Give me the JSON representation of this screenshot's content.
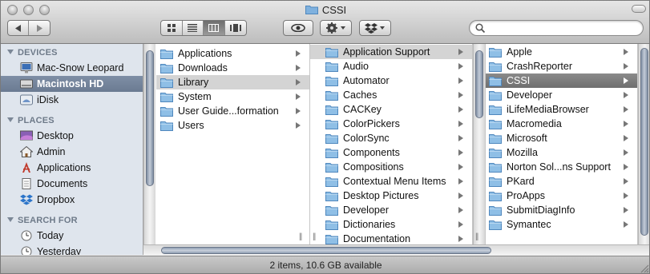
{
  "window": {
    "title": "CSSI"
  },
  "toolbar": {
    "view_buttons": [
      "icon-view",
      "list-view",
      "column-view",
      "coverflow-view"
    ],
    "active_view": "column-view"
  },
  "sidebar": {
    "devices_header": "DEVICES",
    "places_header": "PLACES",
    "search_header": "SEARCH FOR",
    "devices": [
      {
        "label": "Mac-Snow Leopard",
        "icon": "imac-icon"
      },
      {
        "label": "Macintosh HD",
        "icon": "hard-drive-icon",
        "selected": true
      },
      {
        "label": "iDisk",
        "icon": "idisk-icon"
      }
    ],
    "places": [
      {
        "label": "Desktop",
        "icon": "desktop-icon"
      },
      {
        "label": "Admin",
        "icon": "home-icon"
      },
      {
        "label": "Applications",
        "icon": "applications-icon"
      },
      {
        "label": "Documents",
        "icon": "documents-icon"
      },
      {
        "label": "Dropbox",
        "icon": "dropbox-icon"
      }
    ],
    "search": [
      {
        "label": "Today",
        "icon": "clock-icon"
      },
      {
        "label": "Yesterday",
        "icon": "clock-icon"
      }
    ]
  },
  "columns": [
    {
      "items": [
        {
          "label": "Applications",
          "arrow": true
        },
        {
          "label": "Downloads",
          "arrow": true
        },
        {
          "label": "Library",
          "arrow": true,
          "selected": true
        },
        {
          "label": "System",
          "arrow": true
        },
        {
          "label": "User Guide...formation",
          "arrow": true
        },
        {
          "label": "Users",
          "arrow": true
        }
      ]
    },
    {
      "items": [
        {
          "label": "Application Support",
          "arrow": true,
          "selected": true
        },
        {
          "label": "Audio",
          "arrow": true
        },
        {
          "label": "Automator",
          "arrow": true
        },
        {
          "label": "Caches",
          "arrow": true
        },
        {
          "label": "CACKey",
          "arrow": true
        },
        {
          "label": "ColorPickers",
          "arrow": true
        },
        {
          "label": "ColorSync",
          "arrow": true
        },
        {
          "label": "Components",
          "arrow": true
        },
        {
          "label": "Compositions",
          "arrow": true
        },
        {
          "label": "Contextual Menu Items",
          "arrow": true
        },
        {
          "label": "Desktop Pictures",
          "arrow": true
        },
        {
          "label": "Developer",
          "arrow": true
        },
        {
          "label": "Dictionaries",
          "arrow": true
        },
        {
          "label": "Documentation",
          "arrow": true
        }
      ]
    },
    {
      "items": [
        {
          "label": "Apple",
          "arrow": true
        },
        {
          "label": "CrashReporter",
          "arrow": true
        },
        {
          "label": "CSSI",
          "arrow": true,
          "active": true
        },
        {
          "label": "Developer",
          "arrow": true
        },
        {
          "label": "iLifeMediaBrowser",
          "arrow": true
        },
        {
          "label": "Macromedia",
          "arrow": true
        },
        {
          "label": "Microsoft",
          "arrow": true
        },
        {
          "label": "Mozilla",
          "arrow": true
        },
        {
          "label": "Norton Sol...ns Support",
          "arrow": true
        },
        {
          "label": "PKard",
          "arrow": true
        },
        {
          "label": "ProApps",
          "arrow": true
        },
        {
          "label": "SubmitDiagInfo",
          "arrow": true
        },
        {
          "label": "Symantec",
          "arrow": true
        }
      ]
    }
  ],
  "status": {
    "text": "2 items, 10.6 GB available"
  }
}
